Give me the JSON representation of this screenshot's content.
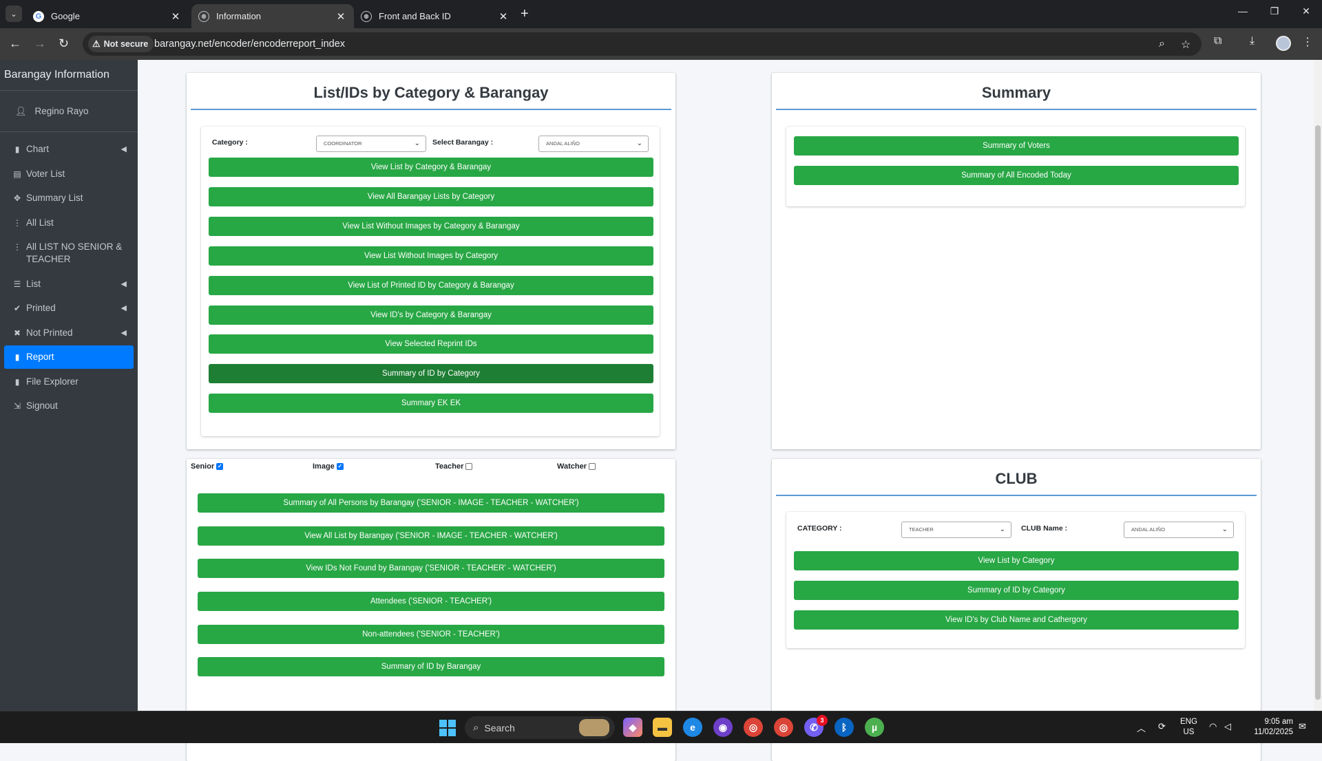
{
  "browser": {
    "tabs": [
      {
        "title": "Google",
        "icon": "google-icon"
      },
      {
        "title": "Information",
        "icon": "globe-icon",
        "active": true
      },
      {
        "title": "Front and Back ID",
        "icon": "globe-icon"
      }
    ],
    "security_label": "Not secure",
    "url": "barangay.net/encoder/encoderreport_index"
  },
  "sidebar": {
    "brand": "Barangay Information",
    "user": "Regino Rayo",
    "items": [
      {
        "label": "Chart",
        "icon": "file-icon",
        "caret": true
      },
      {
        "label": "Voter List",
        "icon": "list-alt-icon"
      },
      {
        "label": "Summary List",
        "icon": "arrows-icon"
      },
      {
        "label": "All List",
        "icon": "vertical-dots-icon"
      },
      {
        "label": "All LIST NO SENIOR & TEACHER",
        "icon": "vertical-dots-icon"
      },
      {
        "label": "List",
        "icon": "list-icon",
        "caret": true
      },
      {
        "label": "Printed",
        "icon": "check-icon",
        "caret": true
      },
      {
        "label": "Not Printed",
        "icon": "times-icon",
        "caret": true
      },
      {
        "label": "Report",
        "icon": "file-icon",
        "active": true
      },
      {
        "label": "File Explorer",
        "icon": "file-icon"
      },
      {
        "label": "Signout",
        "icon": "sign-out-icon"
      }
    ]
  },
  "list_card": {
    "title": "List/IDs by Category & Barangay",
    "category_label": "Category :",
    "category_value": "COORDINATOR",
    "barangay_label": "Select Barangay :",
    "barangay_value": "ANDAL ALIÑO",
    "buttons": [
      "View List by Category & Barangay",
      "View All Barangay Lists by Category",
      "View List Without Images by Category & Barangay",
      "View List Without Images by Category",
      "View List of Printed ID by Category & Barangay",
      "View ID's by Category & Barangay",
      "View Selected Reprint IDs",
      "Summary of ID by Category",
      "Summary EK EK"
    ]
  },
  "filter_card": {
    "checkboxes": [
      {
        "label": "Senior",
        "checked": true
      },
      {
        "label": "Image",
        "checked": true
      },
      {
        "label": "Teacher",
        "checked": false
      },
      {
        "label": "Watcher",
        "checked": false
      }
    ],
    "buttons": [
      "Summary of All Persons by Barangay ('SENIOR - IMAGE - TEACHER - WATCHER')",
      "View All List by Barangay ('SENIOR - IMAGE - TEACHER - WATCHER')",
      "View IDs Not Found by Barangay ('SENIOR - TEACHER' - WATCHER')",
      "Attendees ('SENIOR - TEACHER')",
      "Non-attendees ('SENIOR - TEACHER')",
      "Summary of ID by Barangay"
    ]
  },
  "summary_card": {
    "title": "Summary",
    "buttons": [
      "Summary of Voters",
      "Summary of All Encoded Today"
    ]
  },
  "club_card": {
    "title": "CLUB",
    "category_label": "CATEGORY :",
    "category_value": "TEACHER",
    "club_label": "CLUB Name :",
    "club_value": "ANDAL ALIÑO",
    "buttons": [
      "View List by Category",
      "Summary of ID by Category",
      "View ID's by Club Name and Cathergory"
    ]
  },
  "taskbar": {
    "search_label": "Search",
    "viber_badge": "3",
    "lang_line1": "ENG",
    "lang_line2": "US",
    "time": "9:05 am",
    "date": "11/02/2025"
  },
  "colors": {
    "accent": "#007bff",
    "button_green": "#28a745",
    "sidebar_bg": "#343a40"
  }
}
